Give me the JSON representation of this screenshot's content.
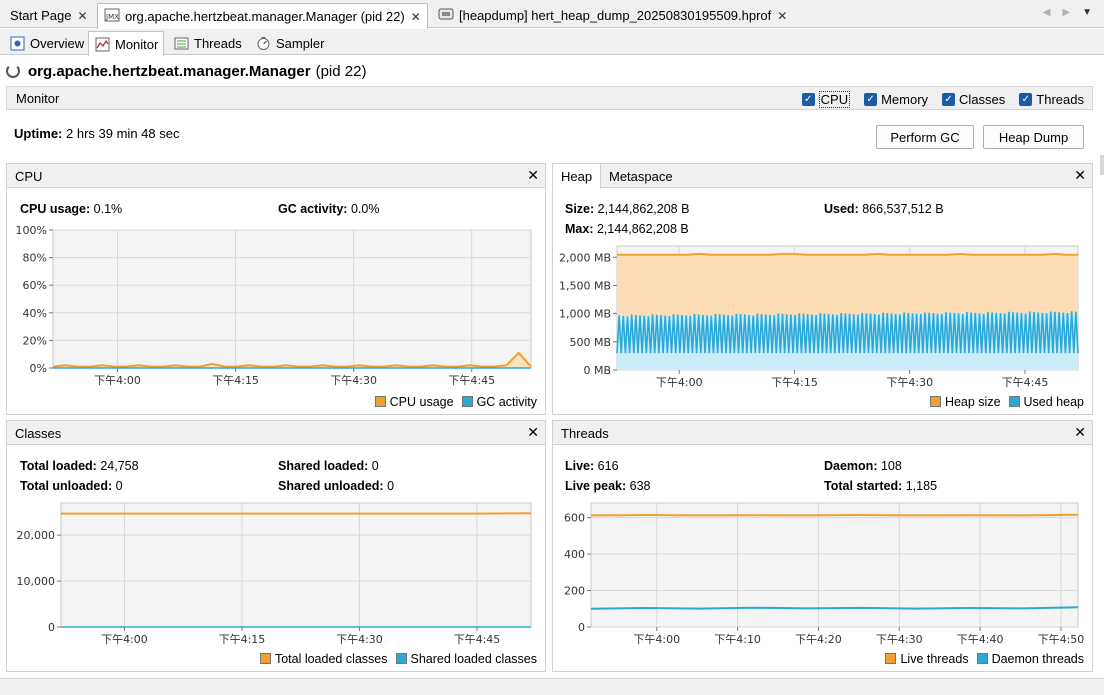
{
  "doc_tabs": [
    {
      "label": "Start Page"
    },
    {
      "label": "org.apache.hertzbeat.manager.Manager (pid 22)"
    },
    {
      "label": "[heapdump] hert_heap_dump_20250830195509.hprof"
    }
  ],
  "sub_tabs": [
    "Overview",
    "Monitor",
    "Threads",
    "Sampler"
  ],
  "title": {
    "name": "org.apache.hertzbeat.manager.Manager",
    "pid": "(pid 22)"
  },
  "monitor": {
    "label": "Monitor",
    "checkboxes": [
      "CPU",
      "Memory",
      "Classes",
      "Threads"
    ],
    "uptime_label": "Uptime:",
    "uptime_value": "2 hrs 39 min 48 sec",
    "perform_gc": "Perform GC",
    "heap_dump": "Heap Dump"
  },
  "cpu_panel": {
    "title": "CPU",
    "usage_label": "CPU usage:",
    "usage_value": "0.1%",
    "gc_label": "GC activity:",
    "gc_value": "0.0%",
    "legend": [
      "CPU usage",
      "GC activity"
    ]
  },
  "heap_panel": {
    "tabs": [
      "Heap",
      "Metaspace"
    ],
    "size_label": "Size:",
    "size_value": "2,144,862,208 B",
    "max_label": "Max:",
    "max_value": "2,144,862,208 B",
    "used_label": "Used:",
    "used_value": "866,537,512 B",
    "legend": [
      "Heap size",
      "Used heap"
    ]
  },
  "classes_panel": {
    "title": "Classes",
    "total_loaded_label": "Total loaded:",
    "total_loaded_value": "24,758",
    "total_unloaded_label": "Total unloaded:",
    "total_unloaded_value": "0",
    "shared_loaded_label": "Shared loaded:",
    "shared_loaded_value": "0",
    "shared_unloaded_label": "Shared unloaded:",
    "shared_unloaded_value": "0",
    "legend": [
      "Total loaded classes",
      "Shared loaded classes"
    ]
  },
  "threads_panel": {
    "title": "Threads",
    "live_label": "Live:",
    "live_value": "616",
    "live_peak_label": "Live peak:",
    "live_peak_value": "638",
    "daemon_label": "Daemon:",
    "daemon_value": "108",
    "total_started_label": "Total started:",
    "total_started_value": "1,185",
    "legend": [
      "Live threads",
      "Daemon threads"
    ]
  },
  "colors": {
    "orange": "#f0a030",
    "blue": "#2aa8d8",
    "heap_fill": "#fbdcb4",
    "used_fill": "#c8ecf8",
    "grid": "#d8d8d8",
    "plot_bg": "#f4f4f4"
  },
  "chart_data": [
    {
      "type": "line",
      "name": "CPU",
      "x_ticks": [
        "下午4:00",
        "下午4:15",
        "下午4:30",
        "下午4:45"
      ],
      "y_ticks": [
        "100%",
        "80%",
        "60%",
        "40%",
        "20%",
        "0%"
      ],
      "ylim": [
        0,
        100
      ],
      "series": [
        {
          "name": "CPU usage",
          "values": [
            1,
            2,
            1,
            1,
            2,
            1,
            1,
            2,
            1,
            1,
            2,
            1,
            1,
            3,
            1,
            1,
            2,
            1,
            1,
            2,
            1,
            1,
            2,
            1,
            1,
            2,
            1,
            1,
            2,
            1,
            1,
            2,
            1,
            1,
            2,
            1,
            1,
            2,
            11,
            1
          ]
        },
        {
          "name": "GC activity",
          "values": [
            0,
            0,
            0,
            0,
            0,
            0,
            0,
            0,
            0,
            0,
            0,
            0,
            0,
            0,
            0,
            0,
            0,
            0,
            0,
            0,
            0,
            0,
            0,
            0,
            0,
            0,
            0,
            0,
            0,
            0,
            0,
            0,
            0,
            0,
            0,
            0,
            0,
            0,
            0,
            0
          ]
        }
      ]
    },
    {
      "type": "area",
      "name": "Heap",
      "x_ticks": [
        "下午4:00",
        "下午4:15",
        "下午4:30",
        "下午4:45"
      ],
      "y_ticks": [
        "2,000 MB",
        "1,500 MB",
        "1,000 MB",
        "500 MB",
        "0 MB"
      ],
      "ylim": [
        0,
        2200
      ],
      "series": [
        {
          "name": "Heap size",
          "values": [
            2045,
            2045,
            2045,
            2045,
            2045,
            2045,
            2045,
            2060,
            2045,
            2045,
            2045,
            2045,
            2045,
            2045,
            2060,
            2060,
            2045,
            2045,
            2045,
            2045,
            2045,
            2045,
            2060,
            2045,
            2045,
            2045,
            2045,
            2045,
            2045,
            2060,
            2045,
            2045,
            2045,
            2045,
            2045,
            2045,
            2045,
            2060,
            2045,
            2045
          ]
        },
        {
          "name": "Used heap",
          "used_range": [
            300,
            1050
          ]
        }
      ]
    },
    {
      "type": "line",
      "name": "Classes",
      "x_ticks": [
        "下午4:00",
        "下午4:15",
        "下午4:30",
        "下午4:45"
      ],
      "y_ticks": [
        "20,000",
        "10,000",
        "0"
      ],
      "ylim": [
        0,
        27000
      ],
      "series": [
        {
          "name": "Total loaded classes",
          "values": [
            24700,
            24700,
            24700,
            24700,
            24700,
            24700,
            24700,
            24700,
            24700,
            24758
          ]
        },
        {
          "name": "Shared loaded classes",
          "values": [
            0,
            0,
            0,
            0,
            0,
            0,
            0,
            0,
            0,
            0
          ]
        }
      ]
    },
    {
      "type": "line",
      "name": "Threads",
      "x_ticks": [
        "下午4:00",
        "下午4:10",
        "下午4:20",
        "下午4:30",
        "下午4:40",
        "下午4:50"
      ],
      "y_ticks": [
        "600",
        "400",
        "200",
        "0"
      ],
      "ylim": [
        0,
        680
      ],
      "series": [
        {
          "name": "Live threads",
          "values": [
            612,
            614,
            612,
            613,
            612,
            614,
            612,
            613,
            612,
            616
          ]
        },
        {
          "name": "Daemon threads",
          "values": [
            100,
            104,
            101,
            106,
            102,
            105,
            101,
            104,
            102,
            108
          ]
        }
      ]
    }
  ]
}
